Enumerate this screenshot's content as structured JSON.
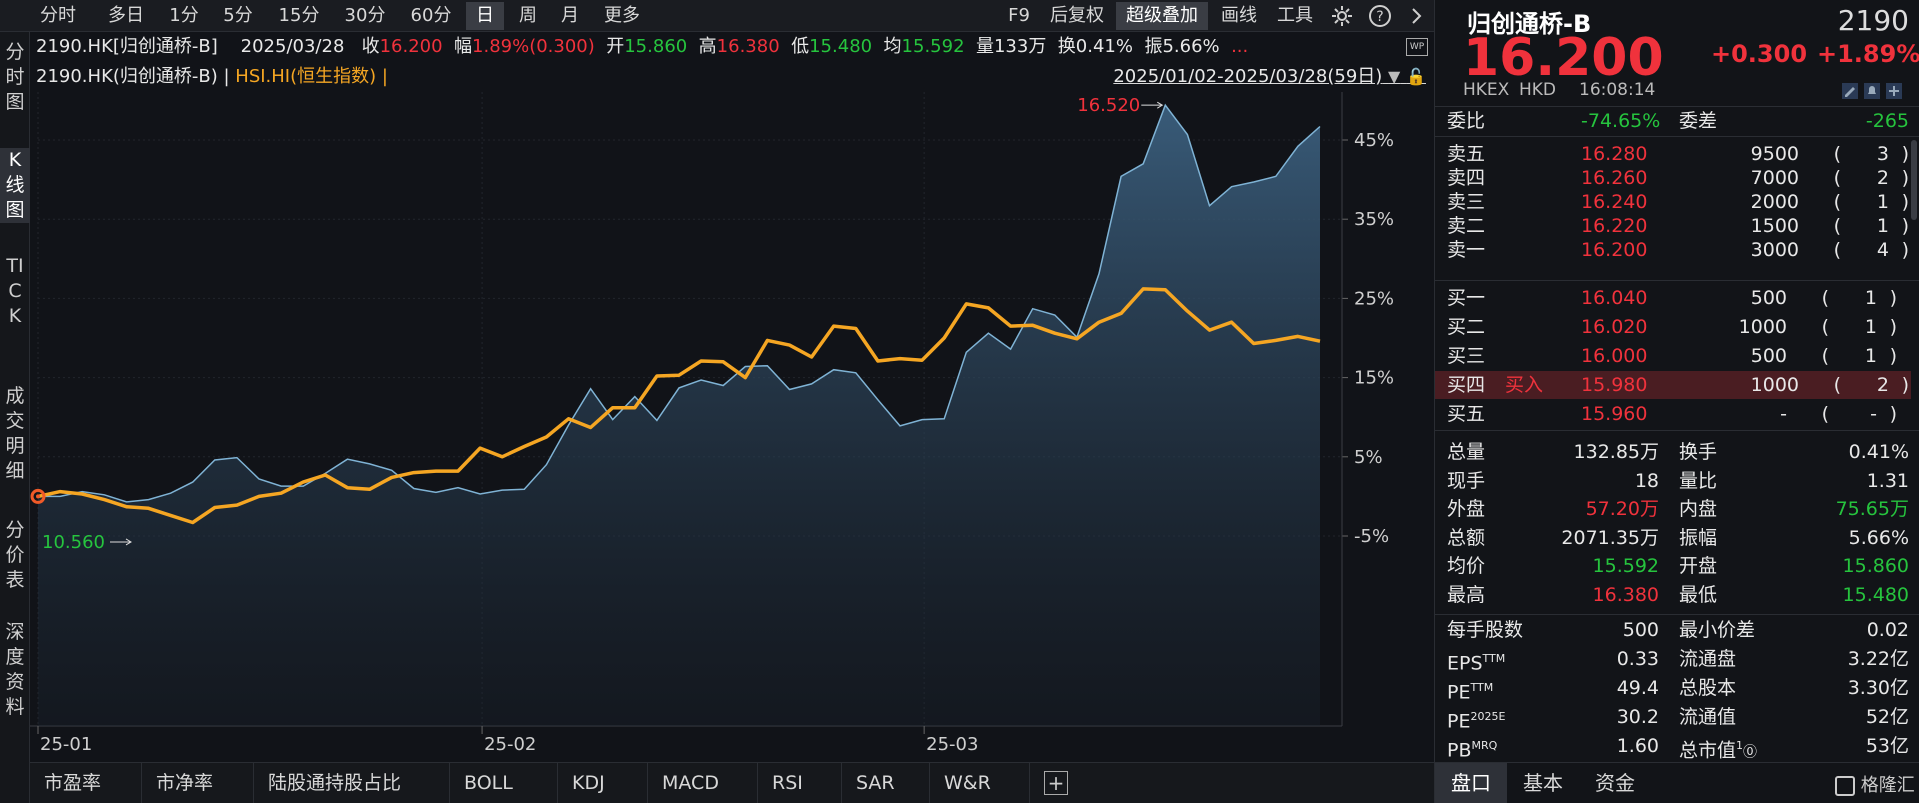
{
  "toolbar": {
    "timeframes": [
      "分时",
      "多日",
      "1分",
      "5分",
      "15分",
      "30分",
      "60分",
      "日",
      "周",
      "月",
      "更多"
    ],
    "active_timeframe": "日",
    "right_items": [
      "F9",
      "后复权",
      "超级叠加",
      "画线",
      "工具"
    ],
    "highlight_item": "超级叠加"
  },
  "left_tabs": [
    "分时图",
    "K线图",
    "TICK",
    "成交明细",
    "分价表",
    "深度资料"
  ],
  "active_left_tab": "K线图",
  "info": {
    "code": "2190.HK[归创通桥-B]",
    "date": "2025/03/28",
    "close_label": "收",
    "close": "16.200",
    "amp_label": "幅",
    "amp": "1.89%(0.300)",
    "open_label": "开",
    "open": "15.860",
    "high_label": "高",
    "high": "16.380",
    "low_label": "低",
    "low": "15.480",
    "avg_label": "均",
    "avg": "15.592",
    "vol_label": "量",
    "vol": "133万",
    "turn_label": "换",
    "turn": "0.41%",
    "swing_label": "振",
    "swing": "5.66%",
    "more": "..."
  },
  "overlay": {
    "primary": "2190.HK(归创通桥-B) |",
    "secondary": "HSI.HI(恒生指数) |",
    "range": "2025/01/02-2025/03/28(59日)"
  },
  "chart_data": {
    "type": "area",
    "x_labels": [
      "25-01",
      "25-02",
      "25-03"
    ],
    "y_ticks": [
      "45%",
      "35%",
      "25%",
      "15%",
      "5%",
      "-5%"
    ],
    "ylim": [
      -5,
      45
    ],
    "high_label": "16.520",
    "low_label": "10.560",
    "series": [
      {
        "color": "#7fb3d5",
        "values": [
          0,
          0,
          0.6,
          0.2,
          -0.7,
          -0.4,
          0.4,
          1.8,
          4.6,
          4.9,
          2.2,
          1.3,
          1.3,
          2.9,
          4.7,
          4.1,
          3.3,
          1.0,
          0.5,
          1.1,
          0.3,
          0.8,
          0.9,
          4.0,
          9.0,
          13.6,
          9.7,
          12.6,
          9.6,
          13.7,
          14.7,
          14.0,
          16.4,
          16.5,
          13.5,
          14.2,
          16.0,
          15.6,
          12.2,
          8.9,
          9.7,
          9.8,
          18.2,
          20.6,
          18.6,
          23.7,
          22.9,
          20.1,
          28.1,
          40.4,
          42.0,
          49.4,
          45.7,
          36.7,
          39.1,
          39.7,
          40.4,
          44.2,
          46.7
        ]
      },
      {
        "color": "#f5a623",
        "values": [
          0,
          0.6,
          0.3,
          -0.4,
          -1.3,
          -1.5,
          -2.4,
          -3.3,
          -1.4,
          -1.1,
          0,
          0.4,
          1.8,
          2.7,
          1.1,
          0.9,
          2.4,
          3.0,
          3.2,
          3.2,
          6.1,
          5.0,
          6.3,
          7.5,
          9.8,
          8.7,
          11.2,
          11.2,
          15.2,
          15.3,
          17.1,
          17.0,
          15.0,
          19.7,
          19.1,
          17.6,
          21.5,
          21.2,
          17.1,
          17.4,
          17.2,
          20.0,
          24.3,
          23.8,
          21.5,
          21.6,
          20.6,
          19.9,
          22.0,
          23.1,
          26.2,
          26.1,
          23.4,
          21.0,
          22.0,
          19.3,
          19.7,
          20.2,
          19.6
        ]
      }
    ]
  },
  "bottom_tabs": [
    "市盈率",
    "市净率",
    "陆股通持股占比",
    "BOLL",
    "KDJ",
    "MACD",
    "RSI",
    "SAR",
    "W&R",
    "+"
  ],
  "quote": {
    "name": "归创通桥-B",
    "code": "2190",
    "price": "16.200",
    "change": "+0.300",
    "change_pct": "+1.89%",
    "exchange": "HKEX",
    "currency": "HKD",
    "time": "16:08:14",
    "commission_ratio_label": "委比",
    "commission_ratio": "-74.65%",
    "commission_diff_label": "委差",
    "commission_diff": "-265",
    "asks": [
      {
        "label": "卖五",
        "price": "16.280",
        "vol": "9500",
        "count": "3"
      },
      {
        "label": "卖四",
        "price": "16.260",
        "vol": "7000",
        "count": "2"
      },
      {
        "label": "卖三",
        "price": "16.240",
        "vol": "2000",
        "count": "1"
      },
      {
        "label": "卖二",
        "price": "16.220",
        "vol": "1500",
        "count": "1"
      },
      {
        "label": "卖一",
        "price": "16.200",
        "vol": "3000",
        "count": "4"
      }
    ],
    "bids": [
      {
        "label": "买一",
        "price": "16.040",
        "vol": "500",
        "count": "1",
        "tag": ""
      },
      {
        "label": "买二",
        "price": "16.020",
        "vol": "1000",
        "count": "1",
        "tag": ""
      },
      {
        "label": "买三",
        "price": "16.000",
        "vol": "500",
        "count": "1",
        "tag": ""
      },
      {
        "label": "买四",
        "price": "15.980",
        "vol": "1000",
        "count": "2",
        "tag": "买入"
      },
      {
        "label": "买五",
        "price": "15.960",
        "vol": "-",
        "count": "-",
        "tag": ""
      }
    ],
    "stats": [
      {
        "l1": "总量",
        "v1": "132.85万",
        "c1": "white",
        "l2": "换手",
        "v2": "0.41%",
        "c2": "white"
      },
      {
        "l1": "现手",
        "v1": "18",
        "c1": "white",
        "l2": "量比",
        "v2": "1.31",
        "c2": "white"
      },
      {
        "l1": "外盘",
        "v1": "57.20万",
        "c1": "red",
        "l2": "内盘",
        "v2": "75.65万",
        "c2": "green"
      },
      {
        "l1": "总额",
        "v1": "2071.35万",
        "c1": "white",
        "l2": "振幅",
        "v2": "5.66%",
        "c2": "white"
      },
      {
        "l1": "均价",
        "v1": "15.592",
        "c1": "green",
        "l2": "开盘",
        "v2": "15.860",
        "c2": "green"
      },
      {
        "l1": "最高",
        "v1": "16.380",
        "c1": "red",
        "l2": "最低",
        "v2": "15.480",
        "c2": "green"
      }
    ],
    "stats2": [
      {
        "l1": "每手股数",
        "s1": "",
        "v1": "500",
        "l2": "最小价差",
        "v2": "0.02"
      },
      {
        "l1": "EPS",
        "s1": "TTM",
        "v1": "0.33",
        "l2": "流通盘",
        "v2": "3.22亿"
      },
      {
        "l1": "PE",
        "s1": "TTM",
        "v1": "49.4",
        "l2": "总股本",
        "v2": "3.30亿"
      },
      {
        "l1": "PE",
        "s1": "2025E",
        "v1": "30.2",
        "l2": "流通值",
        "v2": "52亿"
      },
      {
        "l1": "PB",
        "s1": "MRQ",
        "v1": "1.60",
        "l2": "总市值",
        "v2": "53亿"
      }
    ],
    "mktcap_sup": "1"
  },
  "right_bottom_tabs": [
    "盘口",
    "基本",
    "资金"
  ],
  "brand": "格隆汇"
}
